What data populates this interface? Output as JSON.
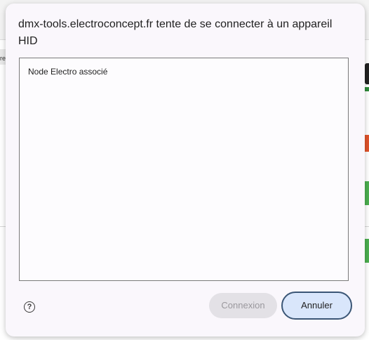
{
  "background": {
    "strip_text": "re"
  },
  "dialog": {
    "title": "dmx-tools.electroconcept.fr tente de se connecter à un appareil HID",
    "devices": [
      {
        "label": "Node Electro associé"
      }
    ],
    "help_icon": "help-circle-icon",
    "help_glyph": "?",
    "connect_label": "Connexion",
    "cancel_label": "Annuler"
  },
  "colors": {
    "dialog_bg": "#faf7fc",
    "cancel_bg": "#d9e6fb",
    "cancel_border": "#3b5676",
    "connect_disabled_bg": "#e3e1e6",
    "connect_disabled_text": "#9a989d"
  }
}
